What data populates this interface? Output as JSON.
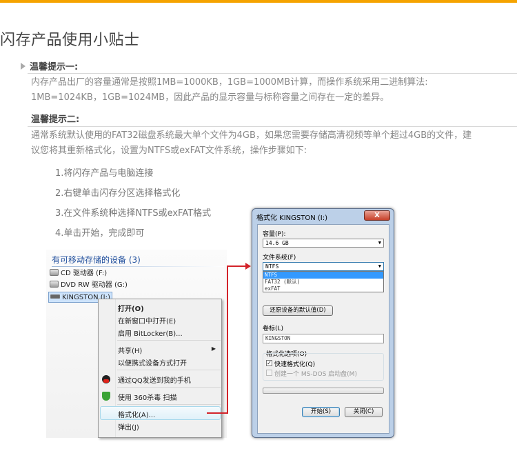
{
  "page": {
    "title": "闪存产品使用小贴士"
  },
  "tips": [
    {
      "heading": "温馨提示一:",
      "lines": [
        "内存产品出厂的容量通常是按照1MB=1000KB，1GB=1000MB计算，而操作系统采用二进制算法:",
        "1MB=1024KB，1GB=1024MB，因此产品的显示容量与标称容量之间存在一定的差异。"
      ]
    },
    {
      "heading": "温馨提示二:",
      "lines": [
        "通常系统默认使用的FAT32磁盘系统最大单个文件为4GB，如果您需要存储高清视频等单个超过4GB的文件，建",
        "议您将其重新格式化，设置为NTFS或exFAT文件系统，操作步骤如下:"
      ]
    }
  ],
  "steps": [
    "1.将闪存产品与电脑连接",
    "2.右键单击闪存分区选择格式化",
    "3.在文件系统种选择NTFS或exFAT格式",
    "4.单击开始，完成即可"
  ],
  "explorer": {
    "section_title": "有可移动存储的设备 (3)",
    "drives": [
      {
        "label": "CD 驱动器 (F:)",
        "icon": "cd-drive-icon"
      },
      {
        "label": "DVD RW 驱动器 (G:)",
        "icon": "dvd-drive-icon"
      },
      {
        "label": "KINGSTON (I:)",
        "icon": "usb-drive-icon"
      }
    ]
  },
  "context_menu": {
    "items": {
      "open": "打开(O)",
      "open_new": "在新窗口中打开(E)",
      "bitlocker": "启用 BitLocker(B)...",
      "share": "共享(H)",
      "portable": "以便携式设备方式打开",
      "qq": "通过QQ发送到我的手机",
      "scan360": "使用 360杀毒 扫描",
      "format": "格式化(A)...",
      "eject": "弹出(J)"
    }
  },
  "format_dialog": {
    "title": "格式化 KINGSTON (I:)",
    "close": "X",
    "capacity_label": "容量(P):",
    "capacity_value": "14.6 GB",
    "filesystem_label": "文件系统(F)",
    "filesystem_value": "NTFS",
    "filesystem_options": [
      "NTFS",
      "FAT32 (默认)",
      "exFAT"
    ],
    "restore_button": "还原设备的默认值(D)",
    "volume_label": "卷标(L)",
    "volume_value": "KINGSTON",
    "options_label": "格式化选项(O)",
    "quick_format": "快速格式化(Q)",
    "msdos_disk": "创建一个 MS-DOS 启动盘(M)",
    "start_button": "开始(S)",
    "close_button": "关闭(C)"
  },
  "colors": {
    "accent": "#f5a300",
    "arrow": "#d3232a",
    "link": "#1f4e9c"
  }
}
